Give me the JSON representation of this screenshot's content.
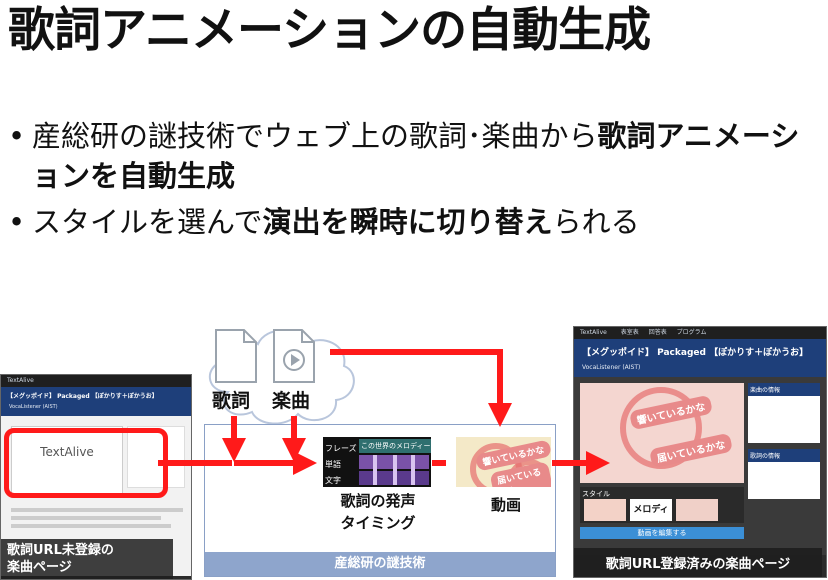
{
  "title": "歌詞アニメーションの自動生成",
  "bullets": [
    {
      "pre": "産総研の謎技術でウェブ上の歌詞･楽曲から",
      "bold": "歌詞アニメーションを自動生成",
      "post": ""
    },
    {
      "pre": "スタイルを選んで",
      "bold": "演出を瞬時に切り替え",
      "post": "られる"
    }
  ],
  "inputs": {
    "lyrics": "歌詞",
    "music": "楽曲"
  },
  "timing_panel": {
    "rows": [
      "フレーズ",
      "単語",
      "文字"
    ],
    "melody_label": "この世界のメロディー"
  },
  "steps": {
    "timing": "歌詞の発声\nタイミング",
    "video": "動画"
  },
  "center_label": "産総研の謎技術",
  "left_page": {
    "app": "TextAlive",
    "song_title": "【メグッポイド】 Packaged 【ぽかりす＋ぽかうお】",
    "sub": "VocaListener (AIST)",
    "logo": "TextAlive",
    "caption": "歌詞URL未登録の\n楽曲ページ"
  },
  "right_page": {
    "app": "TextAlive",
    "nav": [
      "表室表",
      "回答表",
      "プログラム"
    ],
    "song_title": "【メグッポイド】 Packaged 【ぽかりす＋ぽかうお】",
    "sub": "VocaListener (AIST)",
    "anim_text": [
      "響いているかな",
      "届いているかな"
    ],
    "style_label": "スタイル",
    "style_thumb": "メロディー",
    "edit_button": "動画を編集する",
    "side_titles": [
      "楽曲の情報",
      "歌詞の情報"
    ],
    "caption": "歌詞URL登録済みの楽曲ページ"
  },
  "colors": {
    "arrow": "#ff1a1a",
    "accent": "#8ea5cc",
    "header": "#1e3f7a"
  }
}
